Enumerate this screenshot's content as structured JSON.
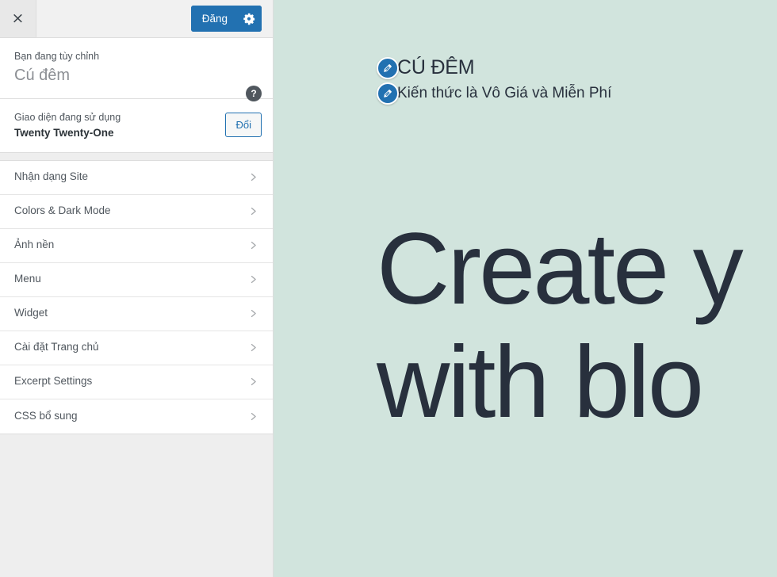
{
  "topbar": {
    "close_label": "×",
    "close_icon": "close-icon",
    "publish_label": "Đăng",
    "settings_icon": "gear-icon"
  },
  "panel_header": {
    "kicker": "Bạn đang tùy chỉnh",
    "site_name": "Cú đêm",
    "help_label": "?",
    "help_icon": "help-circle-icon"
  },
  "theme_row": {
    "label": "Giao diện đang sử dụng",
    "name": "Twenty Twenty-One",
    "change_label": "Đổi"
  },
  "sections": [
    {
      "label": "Nhận dạng Site",
      "icon": "chevron-right-icon"
    },
    {
      "label": "Colors & Dark Mode",
      "icon": "chevron-right-icon"
    },
    {
      "label": "Ảnh nền",
      "icon": "chevron-right-icon"
    },
    {
      "label": "Menu",
      "icon": "chevron-right-icon"
    },
    {
      "label": "Widget",
      "icon": "chevron-right-icon"
    },
    {
      "label": "Cài đặt Trang chủ",
      "icon": "chevron-right-icon"
    },
    {
      "label": "Excerpt Settings",
      "icon": "chevron-right-icon"
    },
    {
      "label": "CSS bổ sung",
      "icon": "chevron-right-icon"
    }
  ],
  "preview": {
    "site_title": "CÚ ĐÊM",
    "tagline": "Kiến thức là Vô Giá và Miễn Phí",
    "edit_icon": "pencil-icon",
    "hero_line_1": "Create y",
    "hero_line_2": "with blo",
    "background_color": "#d1e4dd",
    "text_color": "#28303d"
  },
  "colors": {
    "accent_blue": "#2271b1",
    "sidebar_bg": "#eeeeee",
    "panel_bg": "#ffffff",
    "border": "#dddddd",
    "text_muted": "#50575e"
  }
}
